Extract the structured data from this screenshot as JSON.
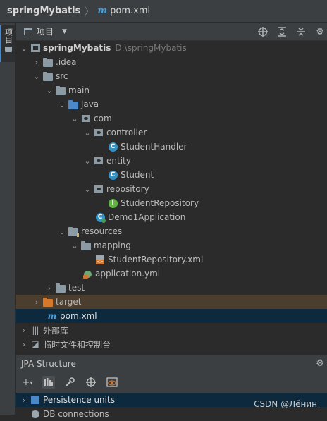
{
  "breadcrumb": {
    "project": "springMybatis",
    "separator": "〉",
    "file_icon": "m",
    "file": "pom.xml"
  },
  "left_stripe": {
    "tab_label": "项目"
  },
  "panel": {
    "title": "项目",
    "icons": [
      "globe-target-icon",
      "expand-all-icon",
      "collapse-all-icon",
      "gear-icon"
    ]
  },
  "tree": [
    {
      "label": "springMybatis",
      "path": "D:\\springMybatis",
      "icon": "project-icon",
      "arrow": "expanded",
      "depth": 0,
      "bold": true
    },
    {
      "label": ".idea",
      "icon": "folder-icon",
      "arrow": "collapsed",
      "depth": 1
    },
    {
      "label": "src",
      "icon": "folder-icon",
      "arrow": "expanded",
      "depth": 1
    },
    {
      "label": "main",
      "icon": "folder-icon",
      "arrow": "expanded",
      "depth": 2
    },
    {
      "label": "java",
      "icon": "source-folder-icon",
      "arrow": "expanded",
      "depth": 3
    },
    {
      "label": "com",
      "icon": "package-icon",
      "arrow": "expanded",
      "depth": 4
    },
    {
      "label": "controller",
      "icon": "package-icon",
      "arrow": "expanded",
      "depth": 5
    },
    {
      "label": "StudentHandler",
      "icon": "class-icon",
      "arrow": "none",
      "depth": 6
    },
    {
      "label": "entity",
      "icon": "package-icon",
      "arrow": "expanded",
      "depth": 5
    },
    {
      "label": "Student",
      "icon": "class-icon",
      "arrow": "none",
      "depth": 6
    },
    {
      "label": "repository",
      "icon": "package-icon",
      "arrow": "expanded",
      "depth": 5
    },
    {
      "label": "StudentRepository",
      "icon": "interface-icon",
      "arrow": "none",
      "depth": 6
    },
    {
      "label": "Demo1Application",
      "icon": "spring-boot-class-icon",
      "arrow": "none",
      "depth": 5
    },
    {
      "label": "resources",
      "icon": "resources-folder-icon",
      "arrow": "expanded",
      "depth": 3
    },
    {
      "label": "mapping",
      "icon": "folder-icon",
      "arrow": "expanded",
      "depth": 4
    },
    {
      "label": "StudentRepository.xml",
      "icon": "xml-file-icon",
      "arrow": "none",
      "depth": 5
    },
    {
      "label": "application.yml",
      "icon": "yml-file-icon",
      "arrow": "none",
      "depth": 4
    },
    {
      "label": "test",
      "icon": "folder-icon",
      "arrow": "collapsed",
      "depth": 2
    },
    {
      "label": "target",
      "icon": "excluded-folder-icon",
      "arrow": "collapsed",
      "depth": 1,
      "excluded": true
    },
    {
      "label": "pom.xml",
      "icon": "maven-file-icon",
      "arrow": "none",
      "depth": 1,
      "selected": true
    },
    {
      "label": "外部库",
      "icon": "library-icon",
      "arrow": "collapsed",
      "depth": 0
    },
    {
      "label": "临时文件和控制台",
      "icon": "scratches-icon",
      "arrow": "collapsed",
      "depth": 0
    }
  ],
  "jpa": {
    "title": "JPA Structure",
    "toolbar": [
      "add-icon",
      "chart-icon",
      "wrench-icon",
      "target-icon",
      "eye-icon"
    ],
    "items": [
      {
        "label": "Persistence units",
        "icon": "persistence-icon",
        "arrow": "collapsed"
      },
      {
        "label": "DB connections",
        "icon": "database-icon",
        "arrow": "none"
      }
    ]
  },
  "watermark": "CSDN @Лёнин"
}
